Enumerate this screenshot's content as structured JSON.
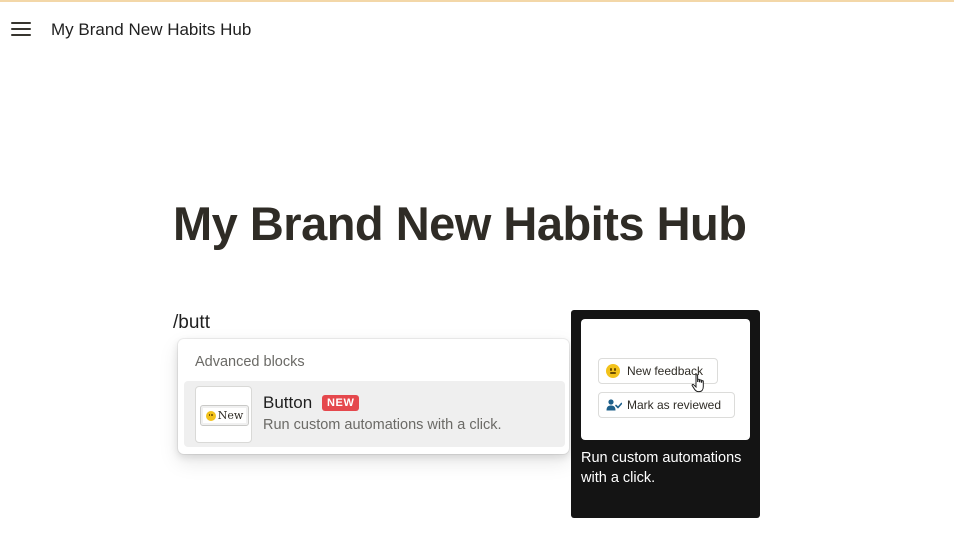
{
  "topbar": {
    "menu_icon": "hamburger-menu-icon",
    "breadcrumb": "My Brand New Habits Hub",
    "accent_color": "#f3d7a8"
  },
  "page": {
    "title": "My Brand New Habits Hub",
    "editor_text": "/butt"
  },
  "slash_menu": {
    "section_label": "Advanced blocks",
    "items": [
      {
        "title": "Button",
        "badge": "NEW",
        "badge_color": "#e5484d",
        "description": "Run custom automations with a click.",
        "thumbnail": {
          "icon": "smiley-icon",
          "label": "New"
        }
      }
    ]
  },
  "preview": {
    "buttons": [
      {
        "icon": "smiley-icon",
        "label": "New feedback"
      },
      {
        "icon": "person-check-icon",
        "label": "Mark as reviewed"
      }
    ],
    "cursor_icon": "hand-pointer-icon",
    "description": "Run custom automations with a click."
  }
}
